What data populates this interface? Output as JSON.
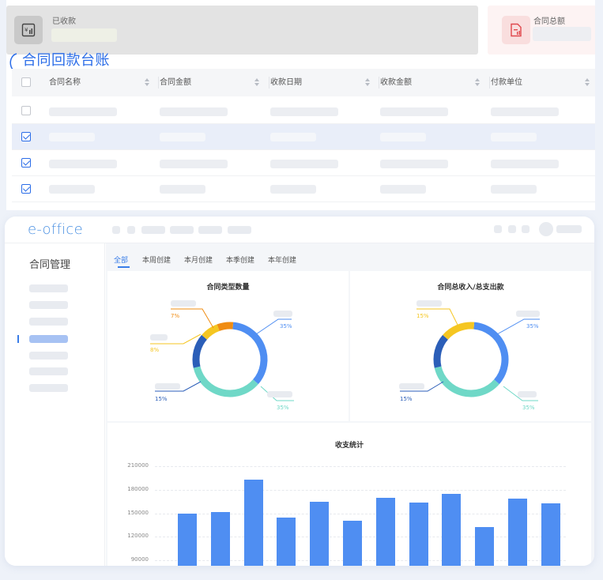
{
  "summary_cards": {
    "received": {
      "label": "已收款",
      "icon": "yen-chart-icon"
    },
    "contract_total": {
      "label": "合同总额",
      "icon": "document-chart-icon"
    }
  },
  "ledger": {
    "title": "合同回款台账",
    "columns": [
      "合同名称",
      "合同金额",
      "收款日期",
      "收款金额",
      "付款单位"
    ],
    "rows": [
      {
        "checked": false,
        "selected": false
      },
      {
        "checked": true,
        "selected": true
      },
      {
        "checked": true,
        "selected": false
      },
      {
        "checked": true,
        "selected": false
      }
    ]
  },
  "app": {
    "logo": "e-office",
    "sidebar_title": "合同管理",
    "tabs": [
      "全部",
      "本周创建",
      "本月创建",
      "本季创建",
      "本年创建"
    ],
    "active_tab": 0
  },
  "colors": {
    "accent": "#2b6de8",
    "donut_blue": "#4f8ef2",
    "donut_teal": "#6fd8c7",
    "donut_navy": "#2b5eb8",
    "donut_yellow": "#f5c621",
    "donut_orange": "#f08c12",
    "bar": "#4f8ef2"
  },
  "chart_data": [
    {
      "type": "pie",
      "title": "合同类型数量",
      "slices": [
        {
          "label": "35%",
          "value": 35,
          "color": "#4f8ef2"
        },
        {
          "label": "35%",
          "value": 35,
          "color": "#6fd8c7"
        },
        {
          "label": "15%",
          "value": 15,
          "color": "#2b5eb8"
        },
        {
          "label": "8%",
          "value": 8,
          "color": "#f5c621"
        },
        {
          "label": "7%",
          "value": 7,
          "color": "#f08c12"
        }
      ]
    },
    {
      "type": "pie",
      "title": "合同总收入/总支出款",
      "slices": [
        {
          "label": "35%",
          "value": 35,
          "color": "#4f8ef2"
        },
        {
          "label": "35%",
          "value": 35,
          "color": "#6fd8c7"
        },
        {
          "label": "15%",
          "value": 15,
          "color": "#2b5eb8"
        },
        {
          "label": "15%",
          "value": 15,
          "color": "#f5c621"
        }
      ]
    },
    {
      "type": "bar",
      "title": "收支统计",
      "y_ticks": [
        "210000",
        "180000",
        "150000",
        "120000",
        "90000"
      ],
      "ylim": [
        90000,
        210000
      ],
      "grid": true,
      "values": [
        150000,
        152000,
        193000,
        144000,
        165000,
        140000,
        170000,
        164000,
        175000,
        132000,
        169000,
        163000
      ]
    }
  ]
}
